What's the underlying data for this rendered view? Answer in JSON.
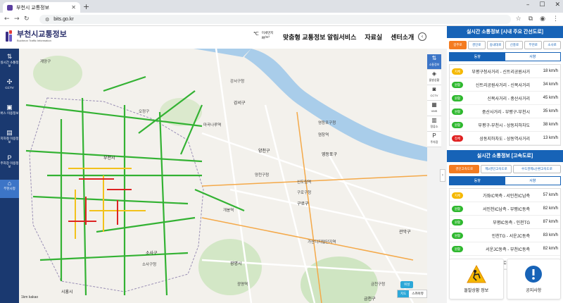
{
  "browser": {
    "tab_title": "부천시 교통정보",
    "url": "bits.go.kr"
  },
  "site": {
    "logo_title": "부천시교통정보",
    "logo_sub": "Bucheon Traffic Information",
    "weather_temp": "℃",
    "weather_dust_label": "미세먼지",
    "weather_dust_unit": "㎍/m³",
    "menu": [
      "맞춤형 교통정보 알림서비스",
      "자료실",
      "센터소개"
    ]
  },
  "left_nav": [
    {
      "icon": "swap-icon",
      "label": "실시간 소통정보",
      "active": false
    },
    {
      "icon": "cctv-icon",
      "label": "CCTV",
      "active": false
    },
    {
      "icon": "bus-icon",
      "label": "버스 이용정보",
      "active": false
    },
    {
      "icon": "subway-icon",
      "label": "지하철 이용정보",
      "active": false
    },
    {
      "icon": "parking-icon",
      "label": "주차장 이용정보",
      "active": false
    },
    {
      "icon": "city-icon",
      "label": "부천시청",
      "active": true
    }
  ],
  "map": {
    "labels": [
      "계양구",
      "강서구청",
      "강서구",
      "마곡나루역",
      "염창역",
      "영등포구청",
      "영등포구",
      "양천구",
      "양천구청",
      "구로구청",
      "구로구",
      "금천구",
      "관악구",
      "금천구청",
      "부천시",
      "오정구",
      "소사구",
      "소사구청",
      "광명시",
      "광명역",
      "시흥시",
      "가산디지털단지역",
      "개봉역",
      "신도림역"
    ],
    "scale": "1km",
    "provider": "kakao",
    "btn_hybrid": "위성",
    "type_map": "지도",
    "type_sky": "스카이뷰"
  },
  "toolstrip": [
    {
      "icon": "flow-icon",
      "label": "소통정보",
      "active": true
    },
    {
      "icon": "incident-icon",
      "label": "돌발상황",
      "active": false
    },
    {
      "icon": "camera-icon",
      "label": "CCTV",
      "active": false
    },
    {
      "icon": "vms-icon",
      "label": "VMS",
      "active": false
    },
    {
      "icon": "bus-stop-icon",
      "label": "정류소",
      "active": false
    },
    {
      "icon": "parking-icon",
      "label": "주차장",
      "active": false
    }
  ],
  "panel1": {
    "title": "실시간 소통정보 [시내 주요 간선도로]",
    "chips": [
      "길주로",
      "경인로",
      "송내대로",
      "신흥로",
      "부천로",
      "소사로"
    ],
    "directions": [
      "동향",
      "서향"
    ],
    "rows": [
      {
        "status": "지체",
        "color": "#f5b800",
        "name": "부평구청사거리 - 신트리공원사거",
        "speed": "18 km/h"
      },
      {
        "status": "원활",
        "color": "#2eb82e",
        "name": "신트리공원사거리 - 신복사거리",
        "speed": "34 km/h"
      },
      {
        "status": "원활",
        "color": "#2eb82e",
        "name": "신복사거리 - 중산사거리",
        "speed": "45 km/h"
      },
      {
        "status": "원활",
        "color": "#2eb82e",
        "name": "중산사거리 - 부평구-부천시",
        "speed": "35 km/h"
      },
      {
        "status": "원활",
        "color": "#2eb82e",
        "name": "부평구-부천시 - 상동지하차도",
        "speed": "38 km/h"
      },
      {
        "status": "정체",
        "color": "#e02020",
        "name": "상동지하차도 - 상동역사거리",
        "speed": "13 km/h"
      }
    ]
  },
  "panel2": {
    "title": "실시간 소통정보 [고속도로]",
    "chips": [
      "경인고속도로",
      "제2경인고속도로",
      "수도권제1순환고속도로"
    ],
    "directions": [
      "동향",
      "서향"
    ],
    "rows": [
      {
        "status": "지체",
        "color": "#f5b800",
        "name": "가좌IC북측 - 서인천IC남측",
        "speed": "57 km/h"
      },
      {
        "status": "원활",
        "color": "#2eb82e",
        "name": "서인천IC남측 - 부평IC동측",
        "speed": "82 km/h"
      },
      {
        "status": "원활",
        "color": "#2eb82e",
        "name": "부평IC동측 - 인천TG",
        "speed": "87 km/h"
      },
      {
        "status": "원활",
        "color": "#2eb82e",
        "name": "인천TG - 서운JC동측",
        "speed": "83 km/h"
      },
      {
        "status": "원활",
        "color": "#2eb82e",
        "name": "서운JC동측 - 부천IC동측",
        "speed": "82 km/h"
      },
      {
        "status": "원활",
        "color": "#2eb82e",
        "name": "부천IC동측 - 신월IC",
        "speed": "88 km/h"
      }
    ]
  },
  "cards": [
    {
      "icon": "roadwork-icon",
      "label": "돌발상황 정보"
    },
    {
      "icon": "notice-icon",
      "label": "공지사항"
    }
  ],
  "colors": {
    "brand": "#1763b7",
    "nav": "#1a3970",
    "accent": "#f47b20"
  }
}
